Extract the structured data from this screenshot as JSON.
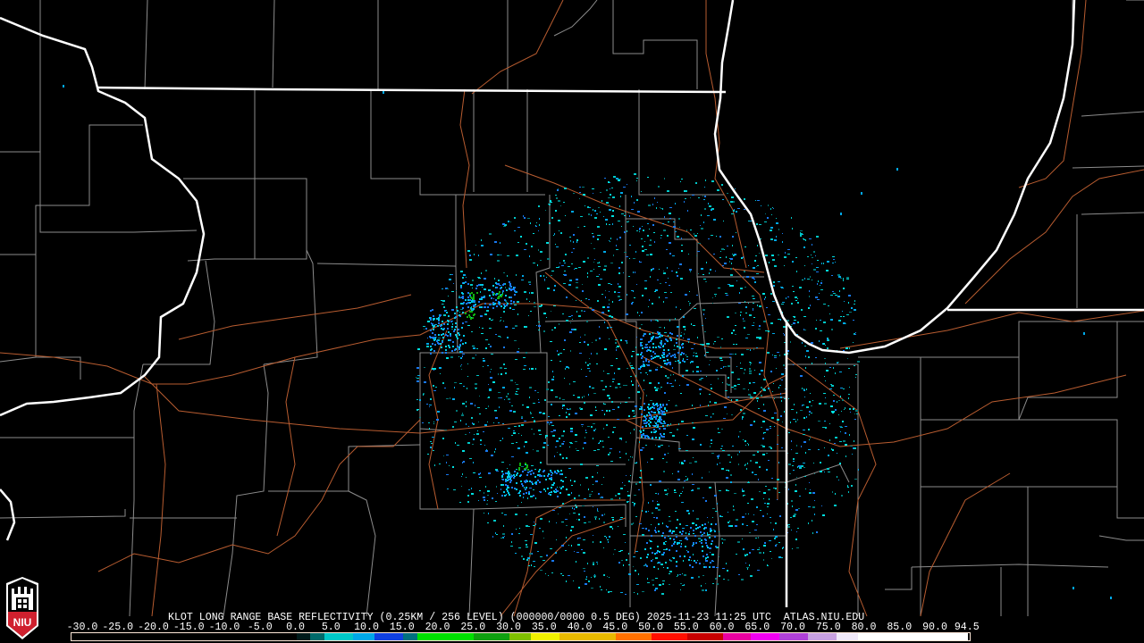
{
  "product_title": "KLOT LONG RANGE BASE REFLECTIVITY (0.25KM / 256 LEVEL) (000000/0000 0.5 DEG) 2025-11-23 11:25 UTC  ATLAS.NIU.EDU",
  "logo_text": "NIU",
  "colorbar": {
    "labels": [
      "-30.0",
      "-25.0",
      "-20.0",
      "-15.0",
      "-10.0",
      "-5.0",
      "0.0",
      "5.0",
      "10.0",
      "15.0",
      "20.0",
      "25.0",
      "30.0",
      "35.0",
      "40.0",
      "45.0",
      "50.0",
      "55.0",
      "60.0",
      "65.0",
      "70.0",
      "75.0",
      "80.0",
      "85.0",
      "90.0",
      "94.5"
    ],
    "values": [
      -30,
      -25,
      -20,
      -15,
      -10,
      -5,
      0,
      5,
      10,
      15,
      20,
      25,
      30,
      35,
      40,
      45,
      50,
      55,
      60,
      65,
      70,
      75,
      80,
      85,
      90,
      94.5
    ],
    "stops": [
      {
        "from": -30,
        "to": 0,
        "color": "#000000"
      },
      {
        "from": 0,
        "to": 2,
        "color": "#001a1a"
      },
      {
        "from": 2,
        "to": 4,
        "color": "#006a6a"
      },
      {
        "from": 4,
        "to": 8,
        "color": "#00c8c8"
      },
      {
        "from": 8,
        "to": 11,
        "color": "#00a8e8"
      },
      {
        "from": 11,
        "to": 15,
        "color": "#1040e0"
      },
      {
        "from": 15,
        "to": 17,
        "color": "#007080"
      },
      {
        "from": 17,
        "to": 25,
        "color": "#00e000"
      },
      {
        "from": 25,
        "to": 30,
        "color": "#10a010"
      },
      {
        "from": 30,
        "to": 33,
        "color": "#80c000"
      },
      {
        "from": 33,
        "to": 37,
        "color": "#f0f000"
      },
      {
        "from": 37,
        "to": 45,
        "color": "#e8b800"
      },
      {
        "from": 45,
        "to": 50,
        "color": "#ff7000"
      },
      {
        "from": 50,
        "to": 55,
        "color": "#ff1000"
      },
      {
        "from": 55,
        "to": 60,
        "color": "#c80000"
      },
      {
        "from": 60,
        "to": 64,
        "color": "#e800a0"
      },
      {
        "from": 64,
        "to": 68,
        "color": "#f000f0"
      },
      {
        "from": 68,
        "to": 72,
        "color": "#b040d8"
      },
      {
        "from": 72,
        "to": 76,
        "color": "#c8a0e0"
      },
      {
        "from": 76,
        "to": 79,
        "color": "#f0e8f8"
      },
      {
        "from": 79,
        "to": 94.5,
        "color": "#ffffff"
      }
    ]
  },
  "colors": {
    "state": "#ffffff",
    "county": "#8c8c8c",
    "road": "#b85c30",
    "logo_red": "#d0202e"
  }
}
